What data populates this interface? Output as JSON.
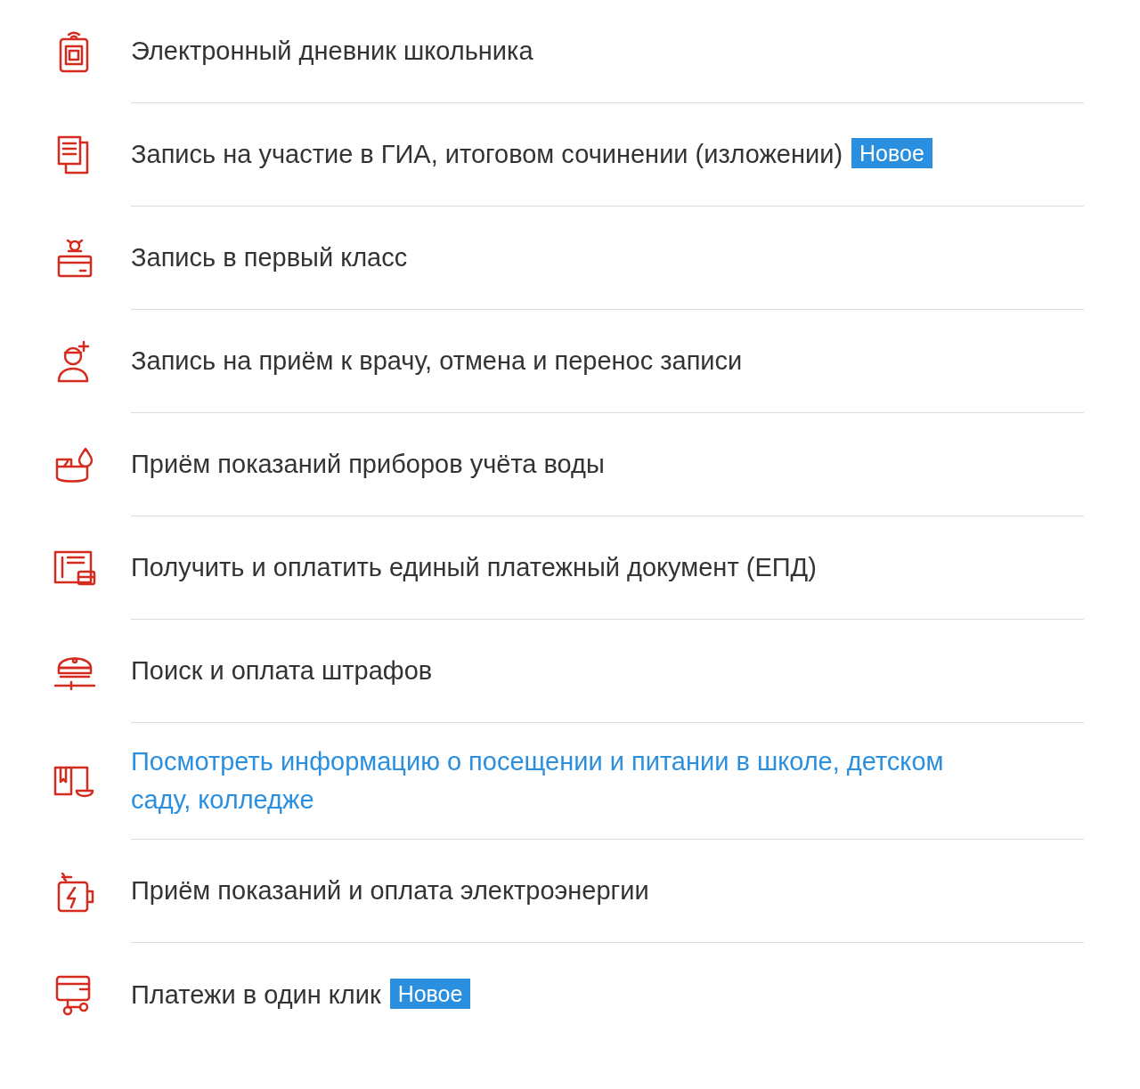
{
  "services": [
    {
      "title": "Электронный дневник школьника",
      "highlighted": false
    },
    {
      "title": "Запись на участие в ГИА, итоговом сочинении (изложении)",
      "badge": "Новое",
      "highlighted": false
    },
    {
      "title": "Запись в первый класс",
      "highlighted": false
    },
    {
      "title": "Запись на приём к врачу, отмена и перенос записи",
      "highlighted": false
    },
    {
      "title": "Приём показаний приборов учёта воды",
      "highlighted": false
    },
    {
      "title": "Получить и оплатить единый платежный документ (ЕПД)",
      "highlighted": false
    },
    {
      "title": "Поиск и оплата штрафов",
      "highlighted": false
    },
    {
      "title": "Посмотреть информацию о посещении и питании в школе, детском саду, колледже",
      "highlighted": true
    },
    {
      "title": "Приём показаний и оплата электроэнергии",
      "highlighted": false
    },
    {
      "title": "Платежи в один клик",
      "badge": "Новое",
      "highlighted": false
    }
  ]
}
